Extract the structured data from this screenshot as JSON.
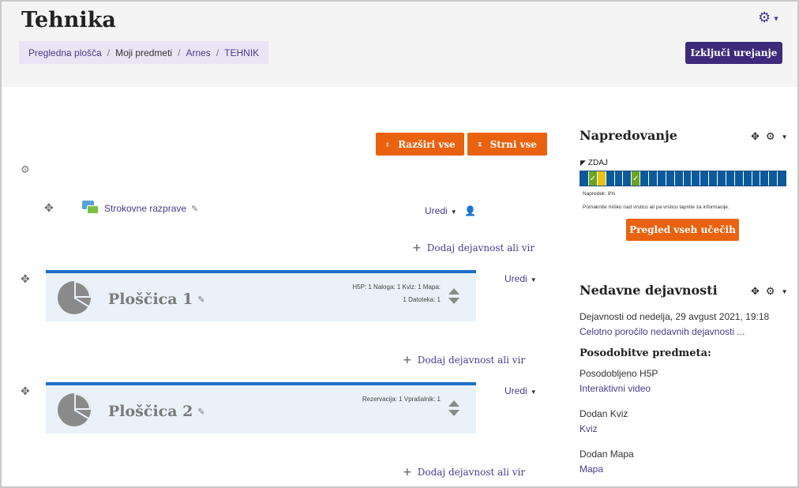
{
  "page": {
    "title": "Tehnika"
  },
  "breadcrumb": [
    "Pregledna plošča",
    "Moji predmeti",
    "Arnes",
    "TEHNIK"
  ],
  "header": {
    "edit_toggle_label": "Izključi urejanje"
  },
  "course": {
    "expand_label": "Razširi vse",
    "collapse_label": "Strni vse",
    "forum": {
      "name": "Strokovne razprave",
      "edit_label": "Uredi"
    },
    "add_activity_label": "Dodaj dejavnost ali vir",
    "tiles": [
      {
        "title": "Ploščica 1",
        "edit_label": "Uredi",
        "summary_line1": "H5P: 1 Naloga: 1 Kviz: 1 Mapa:",
        "summary_line2": "1 Datoteka: 1"
      },
      {
        "title": "Ploščica 2",
        "edit_label": "Uredi",
        "summary_line1": "Rezervacija: 1 Vprašalnik: 1",
        "summary_line2": ""
      }
    ]
  },
  "progress_block": {
    "title": "Napredovanje",
    "now_label": "ZDAJ",
    "cells_total": 24,
    "cells_done": [
      1,
      6
    ],
    "cell_now": 2,
    "progress_text": "Napredek: 8%",
    "hint": "Pomaknite miško nad vrstico ali pa vrstico tapnite za informacije.",
    "button_label": "Pregled vseh učečih"
  },
  "recent_block": {
    "title": "Nedavne dejavnosti",
    "since": "Dejavnosti od nedelja, 29 avgust 2021, 19:18",
    "full_report": "Celotno poročilo nedavnih dejavnosti ...",
    "updates_heading": "Posodobitve predmeta:",
    "items": [
      {
        "action": "Posodobljeno H5P",
        "link": "Interaktivni video"
      },
      {
        "action": "Dodan Kviz",
        "link": "Kviz"
      },
      {
        "action": "Dodan Mapa",
        "link": "Mapa"
      }
    ]
  },
  "colors": {
    "accent": "#3d2a7b",
    "orange": "#e8620f",
    "tile_border": "#1c6fc8",
    "progress": "#0b5a9b",
    "done": "#6ba51e",
    "now": "#e7c317"
  }
}
